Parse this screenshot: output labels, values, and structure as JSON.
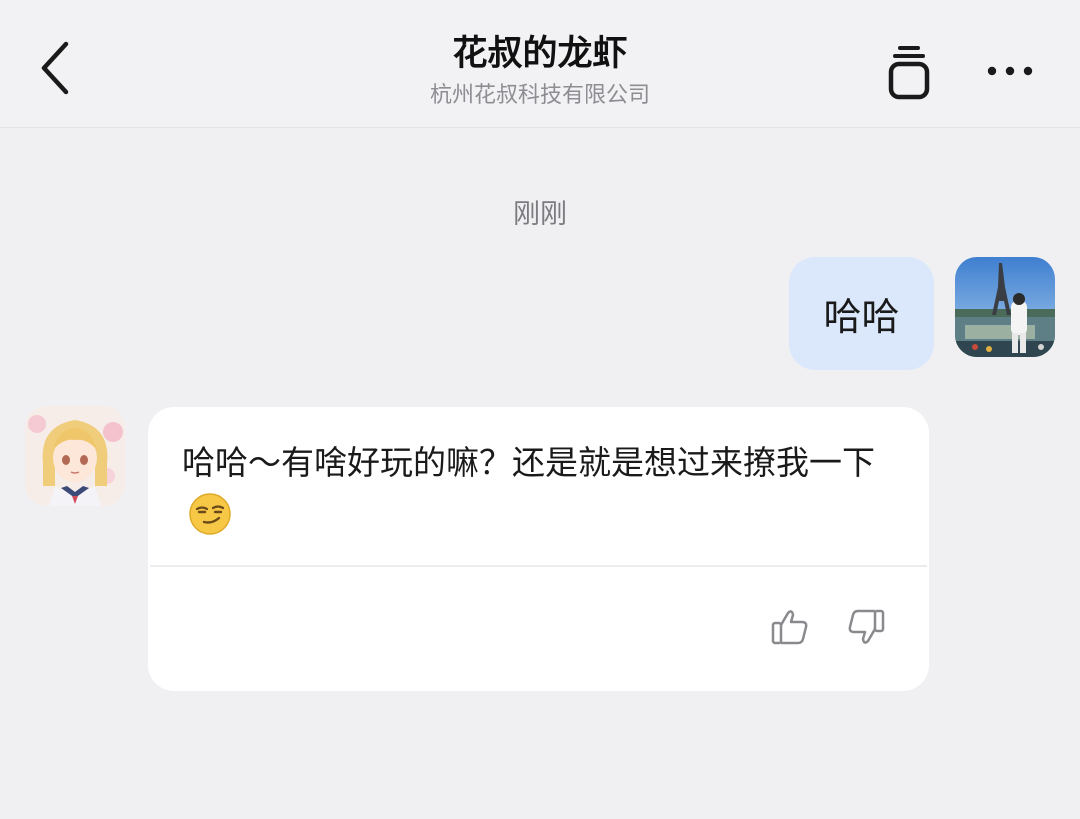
{
  "header": {
    "title": "花叔的龙虾",
    "subtitle": "杭州花叔科技有限公司",
    "back_icon": "chevron-left-icon",
    "share_icon": "stack-cup-icon",
    "more_icon": "more-dots-icon"
  },
  "timestamp": "刚刚",
  "messages": [
    {
      "role": "user",
      "text": "哈哈",
      "avatar": "eiffel-tower-photo-avatar"
    },
    {
      "role": "bot",
      "text": "哈哈～有啥好玩的嘛？还是就是想过来撩我一下",
      "emoji": "smirking-face-emoji",
      "avatar": "anime-girl-avatar"
    }
  ],
  "feedback": {
    "like_icon": "thumbs-up-icon",
    "dislike_icon": "thumbs-down-icon"
  },
  "colors": {
    "background": "#f0f0f3",
    "user_bubble": "#dbe8fc",
    "bot_bubble": "#ffffff",
    "muted_text": "#8d8d92"
  }
}
